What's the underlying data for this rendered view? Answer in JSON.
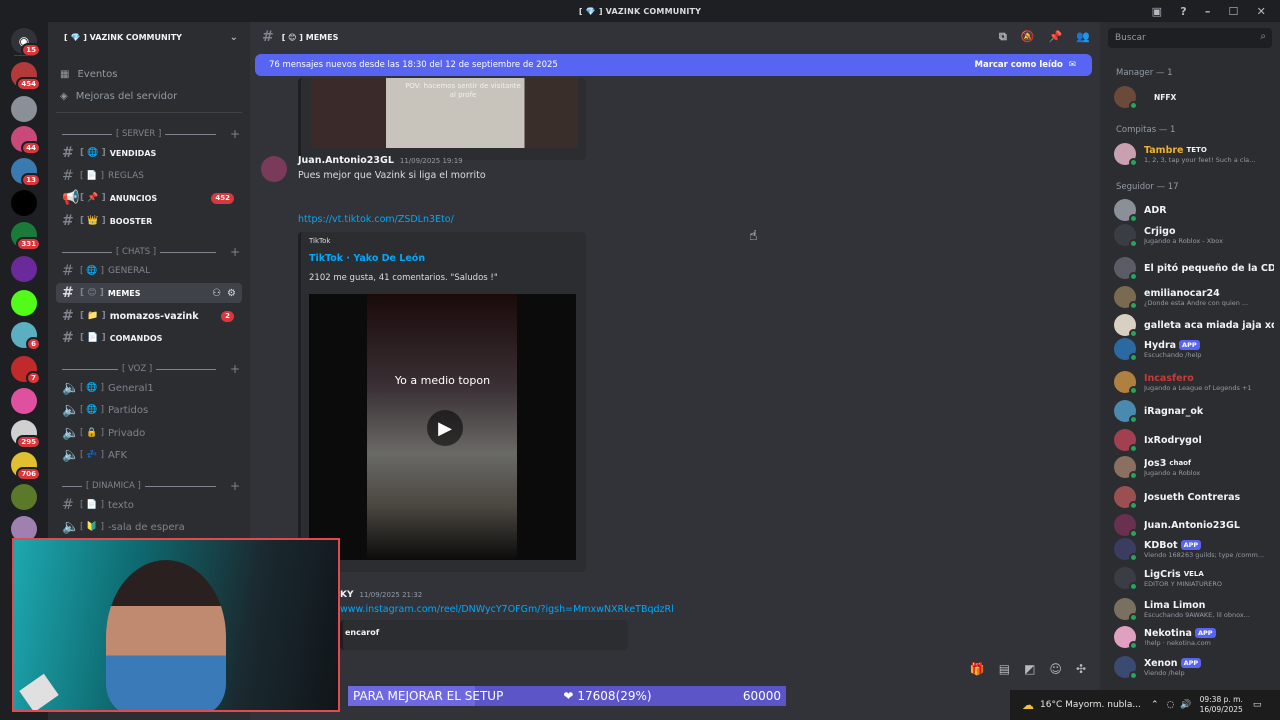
{
  "titlebar": {
    "title": "[ 💎 ] VAZINK COMMUNITY"
  },
  "guilds": {
    "badges": [
      "15",
      "454",
      "44",
      "13",
      "331",
      "6",
      "7",
      "295",
      "706"
    ],
    "home_icon": "discord-logo-icon"
  },
  "server": {
    "name": "[ 💎 ] VAZINK COMMUNITY",
    "top_items": [
      "Eventos",
      "Mejoras del servidor"
    ],
    "categories": [
      {
        "label": "[ SERVER ]"
      },
      {
        "label": "[ CHATS ]"
      },
      {
        "label": "[ VOZ ]"
      },
      {
        "label": "[ DINAMICA ]"
      }
    ],
    "server_channels": [
      {
        "prefix": "[ 🌐 ]",
        "name": "VENDIDAS",
        "bold": true
      },
      {
        "prefix": "[ 📄 ]",
        "name": "REGLAS",
        "bold": false
      },
      {
        "prefix": "[ 📌 ]",
        "name": "ANUNCIOS",
        "bold": true,
        "count": "452"
      },
      {
        "prefix": "[ 👑 ]",
        "name": "BOOSTER",
        "bold": true
      }
    ],
    "chat_channels": [
      {
        "prefix": "[ 🌐 ]",
        "name": "GENERAL",
        "bold": false
      },
      {
        "prefix": "[ 😊 ]",
        "name": "MEMES",
        "bold": true,
        "active": true
      },
      {
        "prefix": "[ 📁 ]",
        "name": "momazos-vazink",
        "bold": true,
        "count": "2"
      },
      {
        "prefix": "[ 📄 ]",
        "name": "COMANDOS",
        "bold": true
      }
    ],
    "voice_channels": [
      {
        "prefix": "[ 🌐 ]",
        "name": "General1"
      },
      {
        "prefix": "[ 🌐 ]",
        "name": "Partidos"
      },
      {
        "prefix": "[ 🔒 ]",
        "name": "Privado"
      },
      {
        "prefix": "[ 💤 ]",
        "name": "AFK"
      }
    ],
    "dinamica_channels": [
      {
        "prefix": "[ 📄 ]",
        "name": "texto"
      },
      {
        "prefix": "[ 🔰 ]",
        "name": "-sala de espera"
      }
    ]
  },
  "channel": {
    "header": "[ 😊 ] MEMES",
    "banner_text": "76 mensajes nuevos desde las 18:30 del 12 de septiembre de 2025",
    "banner_action": "Marcar como leído"
  },
  "messages": {
    "prev_image_caption": "POV: hacemos sentir de visitante al profe",
    "m1": {
      "author": "Juan.Antonio23GL",
      "time": "11/09/2025 19:19",
      "text": "Pues mejor que Vazink si liga el morrito"
    },
    "m1_link": "https://vt.tiktok.com/ZSDLn3Eto/",
    "embed": {
      "provider": "TikTok",
      "title": "TikTok · Yako De León",
      "description": "2102 me gusta, 41 comentarios. \"Saludos !\"",
      "video_caption": "Yo a medio topon"
    },
    "m2": {
      "author": "KY",
      "time": "11/09/2025 21:32"
    },
    "m2_link": "www.instagram.com/reel/DNWycY7OFGm/?igsh=MmxwNXRkeTBqdzRl",
    "m2_embed_title": "encarof"
  },
  "search": {
    "placeholder": "Buscar"
  },
  "members": {
    "groups": [
      {
        "label": "Manager — 1"
      },
      {
        "label": "Compitas — 1"
      },
      {
        "label": "Seguidor — 17"
      }
    ],
    "list": [
      {
        "name": "NFFX",
        "status": "",
        "color": "#f2f3f5",
        "avatar": "#6b4a3a"
      },
      {
        "name": "Tambre",
        "tag": "TETO",
        "status": "1, 2, 3, tap your feet! Such a cla...",
        "color": "#f0b232",
        "avatar": "#c9a0b0"
      },
      {
        "name": "ADR",
        "status": "",
        "color": "#f2f3f5",
        "avatar": "#8a8f98"
      },
      {
        "name": "Crjigo",
        "status": "Jugando a Roblox - Xbox",
        "color": "#f2f3f5",
        "avatar": "#3a3d44"
      },
      {
        "name": "El pitó pequeño de la CD...",
        "status": "",
        "color": "#f2f3f5",
        "avatar": "#5a5d66"
      },
      {
        "name": "emilianocar24",
        "status": "¿Donde esta Andre con quien ...",
        "color": "#f2f3f5",
        "avatar": "#7a6a50"
      },
      {
        "name": "galleta aca miada jaja xd",
        "status": "",
        "color": "#f2f3f5",
        "avatar": "#d8d0c0"
      },
      {
        "name": "Hydra",
        "tag": "APP",
        "status": "Escuchando /help",
        "color": "#f2f3f5",
        "avatar": "#2a6aa0"
      },
      {
        "name": "Incasfero",
        "status": "Jugando a League of Legends +1",
        "color": "#c93a3a",
        "avatar": "#b08040"
      },
      {
        "name": "iRagnar_ok",
        "status": "",
        "color": "#f2f3f5",
        "avatar": "#4a8ab0"
      },
      {
        "name": "IxRodrygol",
        "status": "",
        "color": "#f2f3f5",
        "avatar": "#a04050"
      },
      {
        "name": "Jos3",
        "tag": "chaof",
        "status": "Jugando a Roblox",
        "color": "#f2f3f5",
        "avatar": "#8a7060"
      },
      {
        "name": "Josueth Contreras",
        "status": "",
        "color": "#f2f3f5",
        "avatar": "#9a5050"
      },
      {
        "name": "Juan.Antonio23GL",
        "status": "",
        "color": "#f2f3f5",
        "avatar": "#6a3050"
      },
      {
        "name": "KDBot",
        "tag": "APP",
        "status": "Viendo 168263 guilds; type /comm...",
        "color": "#f2f3f5",
        "avatar": "#3a3d60"
      },
      {
        "name": "LigCris",
        "tag": "VELA",
        "status": "EDITOR Y MINIATURERO",
        "color": "#f2f3f5",
        "avatar": "#3a3d44"
      },
      {
        "name": "Lima Limon",
        "status": "Escuchando 9AWAKE, lil obnox...",
        "color": "#f2f3f5",
        "avatar": "#7a7060"
      },
      {
        "name": "Nekotina",
        "tag": "APP",
        "status": "!help · nekotina.com",
        "color": "#f2f3f5",
        "avatar": "#e0a0c0"
      },
      {
        "name": "Xenon",
        "tag": "APP",
        "status": "Viendo /help",
        "color": "#f2f3f5",
        "avatar": "#3a4a70"
      }
    ]
  },
  "overlay": {
    "label": "PARA MEJORAR EL SETUP",
    "progress_text": "17608(29%)",
    "goal": "60000",
    "progress_fraction": 0.29
  },
  "taskbar": {
    "weather": "16°C  Mayorm. nubla...",
    "time": "09:38 p. m.",
    "date": "16/09/2025"
  }
}
